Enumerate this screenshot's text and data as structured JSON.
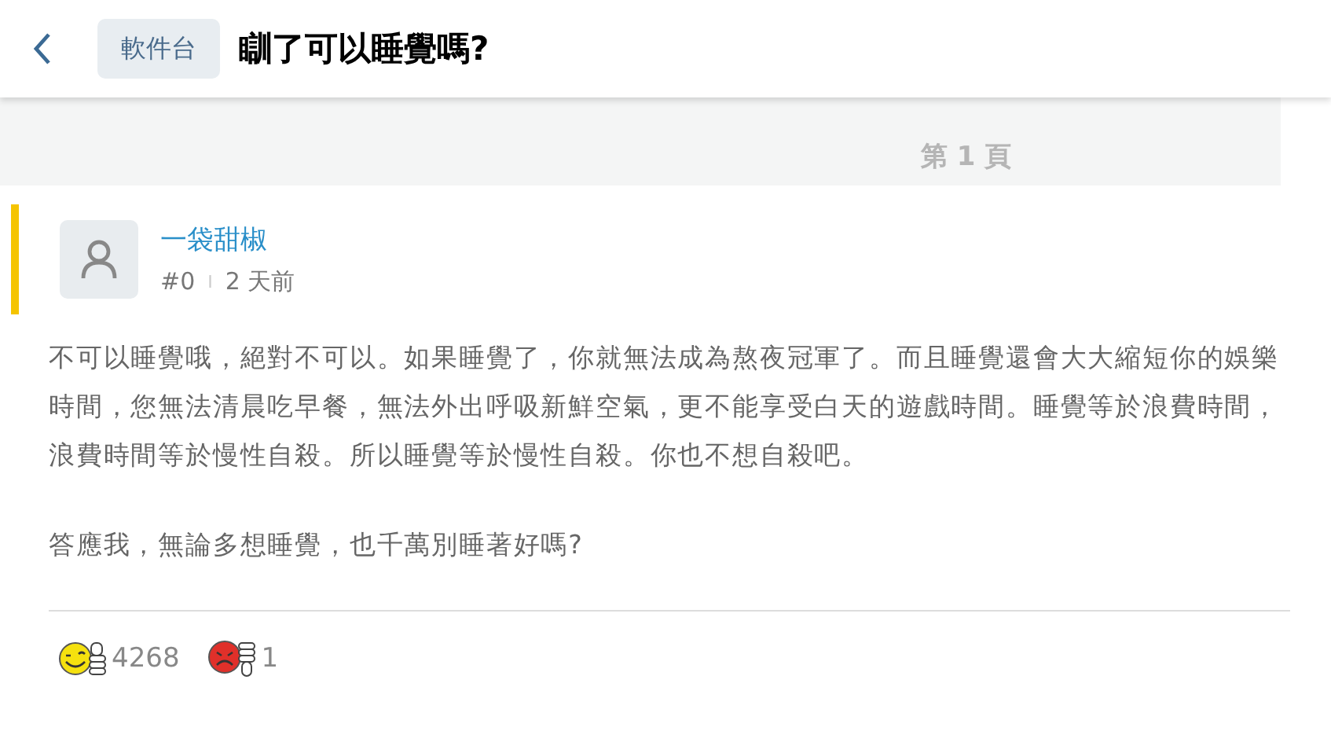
{
  "header": {
    "board": "軟件台",
    "title": "瞓了可以睡覺嗎?"
  },
  "page_label": "第 1 頁",
  "post": {
    "author": "一袋甜椒",
    "floor": "#0",
    "separator": "I",
    "time": "2 天前",
    "highlighted": true,
    "paragraphs": [
      "不可以睡覺哦，絕對不可以。如果睡覺了，你就無法成為熬夜冠軍了。而且睡覺還會大大縮短你的娛樂時間，您無法清晨吃早餐，無法外出呼吸新鮮空氣，更不能享受白天的遊戲時間。睡覺等於浪費時間，浪費時間等於慢性自殺。所以睡覺等於慢性自殺。你也不想自殺吧。",
      "答應我，無論多想睡覺，也千萬別睡著好嗎?"
    ],
    "reactions": [
      {
        "kind": "like",
        "count": "4268"
      },
      {
        "kind": "dislike",
        "count": "1"
      }
    ]
  }
}
